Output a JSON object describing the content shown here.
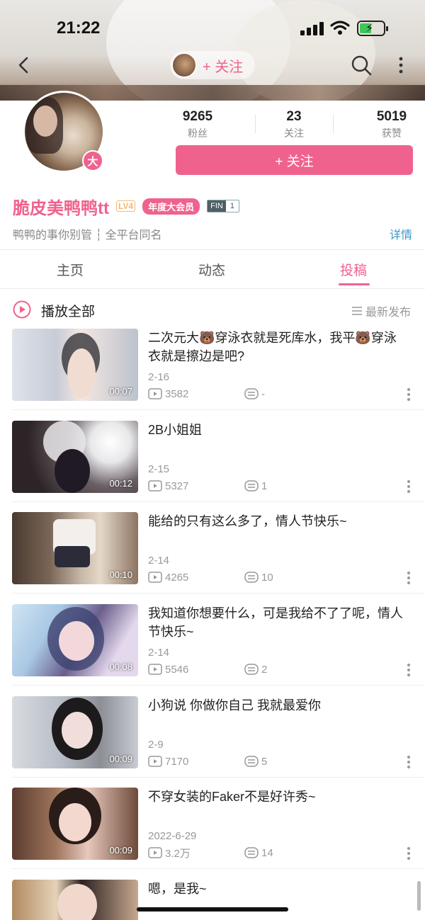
{
  "status_bar": {
    "time": "21:22"
  },
  "nav": {
    "follow_label": "+ 关注"
  },
  "profile": {
    "rank_badge": "大",
    "stats": [
      {
        "value": "9265",
        "label": "粉丝"
      },
      {
        "value": "23",
        "label": "关注"
      },
      {
        "value": "5019",
        "label": "获赞"
      }
    ],
    "follow_button": "+ 关注",
    "username": "脆皮美鸭鸭tt",
    "level": "LV4",
    "vip_badge": "年度大会员",
    "fin_badge": {
      "label": "FIN",
      "value": "1"
    },
    "bio": "鸭鸭的事你别管 ┆ 全平台同名",
    "detail_link": "详情"
  },
  "tabs": [
    {
      "label": "主页",
      "active": false
    },
    {
      "label": "动态",
      "active": false
    },
    {
      "label": "投稿",
      "active": true
    }
  ],
  "list_header": {
    "play_all": "播放全部",
    "sort_label": "最新发布"
  },
  "videos": [
    {
      "title": "二次元大🐻穿泳衣就是死库水，我平🐻穿泳衣就是擦边是吧?",
      "date": "2-16",
      "plays": "3582",
      "comments": "-",
      "duration": "00:07"
    },
    {
      "title": "2B小姐姐",
      "date": "2-15",
      "plays": "5327",
      "comments": "1",
      "duration": "00:12"
    },
    {
      "title": "能给的只有这么多了，情人节快乐~",
      "date": "2-14",
      "plays": "4265",
      "comments": "10",
      "duration": "00:10"
    },
    {
      "title": "我知道你想要什么，可是我给不了了呢，情人节快乐~",
      "date": "2-14",
      "plays": "5546",
      "comments": "2",
      "duration": "00:08"
    },
    {
      "title": "小狗说 你做你自己 我就最爱你",
      "date": "2-9",
      "plays": "7170",
      "comments": "5",
      "duration": "00:09"
    },
    {
      "title": "不穿女装的Faker不是好许秀~",
      "date": "2022-6-29",
      "plays": "3.2万",
      "comments": "14",
      "duration": "00:09"
    },
    {
      "title": "嗯，是我~",
      "date": "",
      "plays": "",
      "comments": "",
      "duration": ""
    }
  ],
  "colors": {
    "accent": "#f0628e",
    "link": "#3a98c9"
  }
}
